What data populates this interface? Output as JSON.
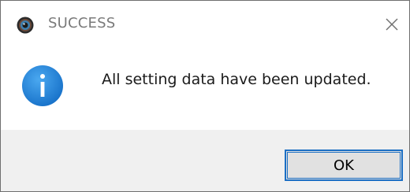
{
  "dialog": {
    "title": "SUCCESS",
    "message": "All setting data have been updated.",
    "ok_label": "OK",
    "icons": {
      "app": "app-icon",
      "close": "close-icon",
      "info": "info-icon"
    },
    "colors": {
      "info_blue": "#1e88e0",
      "accent_border": "#1c6fc4",
      "footer_bg": "#f0f0f0"
    }
  }
}
